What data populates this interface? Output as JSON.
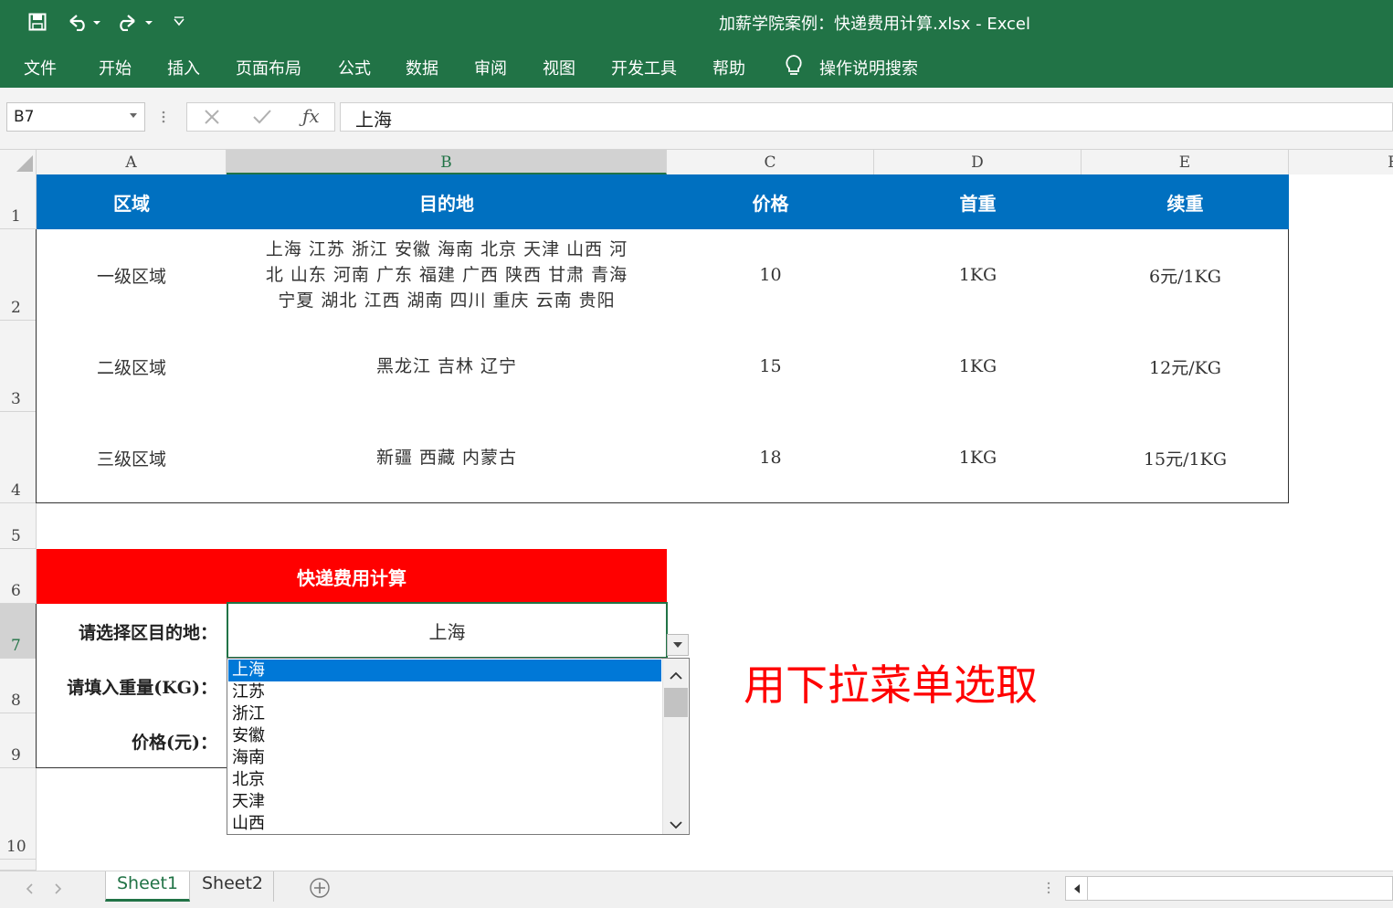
{
  "window": {
    "title": "加薪学院案例：快递费用计算.xlsx  -  Excel",
    "quick_access": [
      "save-icon",
      "undo-icon",
      "redo-icon",
      "customize-icon"
    ]
  },
  "ribbon": {
    "tabs": [
      "文件",
      "开始",
      "插入",
      "页面布局",
      "公式",
      "数据",
      "审阅",
      "视图",
      "开发工具",
      "帮助"
    ],
    "tell_me": "操作说明搜索"
  },
  "formula_bar": {
    "name_box": "B7",
    "formula": "上海"
  },
  "columns": [
    "A",
    "B",
    "C",
    "D",
    "E",
    "F"
  ],
  "rows": [
    "1",
    "2",
    "3",
    "4",
    "5",
    "6",
    "7",
    "8",
    "9",
    "10"
  ],
  "table": {
    "headers": [
      "区域",
      "目的地",
      "价格",
      "首重",
      "续重"
    ],
    "rows": [
      {
        "zone": "一级区域",
        "dest_lines": [
          "上海 江苏 浙江 安徽 海南 北京 天津 山西 河",
          "北 山东 河南 广东 福建 广西 陕西 甘肃 青海",
          "宁夏 湖北 江西 湖南 四川 重庆 云南 贵阳"
        ],
        "price": "10",
        "first": "1KG",
        "extra": "6元/1KG"
      },
      {
        "zone": "二级区域",
        "dest_lines": [
          "黑龙江 吉林 辽宁"
        ],
        "price": "15",
        "first": "1KG",
        "extra": "12元/KG"
      },
      {
        "zone": "三级区域",
        "dest_lines": [
          "新疆 西藏 内蒙古"
        ],
        "price": "18",
        "first": "1KG",
        "extra": "15元/1KG"
      }
    ]
  },
  "calculator": {
    "title": "快递费用计算",
    "dest_label": "请选择区目的地：",
    "dest_value": "上海",
    "weight_label": "请填入重量(KG)：",
    "price_label": "价格(元)："
  },
  "dropdown": {
    "items": [
      "上海",
      "江苏",
      "浙江",
      "安徽",
      "海南",
      "北京",
      "天津",
      "山西"
    ],
    "selected": "上海"
  },
  "annotation": "用下拉菜单选取",
  "sheets": {
    "tabs": [
      "Sheet1",
      "Sheet2"
    ],
    "active": "Sheet1"
  },
  "colors": {
    "excel_green": "#217346",
    "table_header_blue": "#0070c0",
    "calc_header_red": "#ff0000",
    "selection_blue": "#0078d7"
  }
}
